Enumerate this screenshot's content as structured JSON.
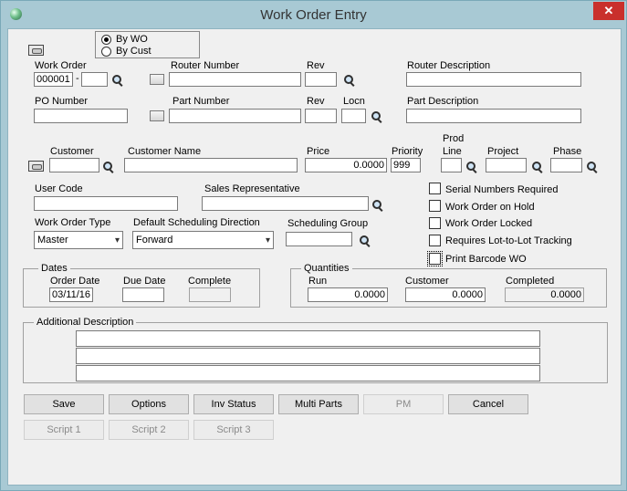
{
  "window": {
    "title": "Work Order Entry",
    "close_glyph": "✕"
  },
  "mode": {
    "options": [
      "By WO",
      "By Cust"
    ],
    "selected": "By WO"
  },
  "work_order": {
    "label": "Work Order",
    "value": "000001",
    "separator": "-",
    "suffix": ""
  },
  "router_number": {
    "label": "Router Number",
    "value": ""
  },
  "router_rev": {
    "label": "Rev",
    "value": ""
  },
  "router_description": {
    "label": "Router Description",
    "value": ""
  },
  "po_number": {
    "label": "PO Number",
    "value": ""
  },
  "part_number": {
    "label": "Part Number",
    "value": ""
  },
  "part_rev": {
    "label": "Rev",
    "value": ""
  },
  "locn": {
    "label": "Locn",
    "value": ""
  },
  "part_description": {
    "label": "Part Description",
    "value": ""
  },
  "customer": {
    "label": "Customer",
    "value": ""
  },
  "customer_name": {
    "label": "Customer Name",
    "value": ""
  },
  "price": {
    "label": "Price",
    "value": "0.0000"
  },
  "priority": {
    "label": "Priority",
    "value": "999"
  },
  "prod_line": {
    "label_line1": "Prod",
    "label_line2": "Line",
    "value": ""
  },
  "project": {
    "label": "Project",
    "value": ""
  },
  "phase": {
    "label": "Phase",
    "value": ""
  },
  "user_code": {
    "label": "User Code",
    "value": ""
  },
  "sales_rep": {
    "label": "Sales Representative",
    "value": ""
  },
  "work_order_type": {
    "label": "Work Order Type",
    "value": "Master"
  },
  "scheduling_direction": {
    "label": "Default Scheduling Direction",
    "value": "Forward"
  },
  "scheduling_group": {
    "label": "Scheduling Group",
    "value": ""
  },
  "checkboxes": [
    {
      "label": "Serial Numbers Required",
      "checked": false
    },
    {
      "label": "Work Order on Hold",
      "checked": false
    },
    {
      "label": "Work Order Locked",
      "checked": false
    },
    {
      "label": "Requires Lot-to-Lot Tracking",
      "checked": false
    },
    {
      "label": "Print Barcode WO",
      "checked": false
    }
  ],
  "dates": {
    "title": "Dates",
    "order_date_label": "Order Date",
    "order_date": "03/11/16",
    "due_date_label": "Due Date",
    "due_date": "",
    "complete_label": "Complete",
    "complete": ""
  },
  "quantities": {
    "title": "Quantities",
    "run_label": "Run",
    "run": "0.0000",
    "customer_label": "Customer",
    "customer": "0.0000",
    "completed_label": "Completed",
    "completed": "0.0000"
  },
  "additional_description": {
    "title": "Additional Description",
    "lines": [
      "",
      "",
      ""
    ]
  },
  "buttons": {
    "save": "Save",
    "options": "Options",
    "inv_status": "Inv Status",
    "multi_parts": "Multi Parts",
    "pm": "PM",
    "cancel": "Cancel",
    "script1": "Script 1",
    "script2": "Script 2",
    "script3": "Script 3"
  }
}
